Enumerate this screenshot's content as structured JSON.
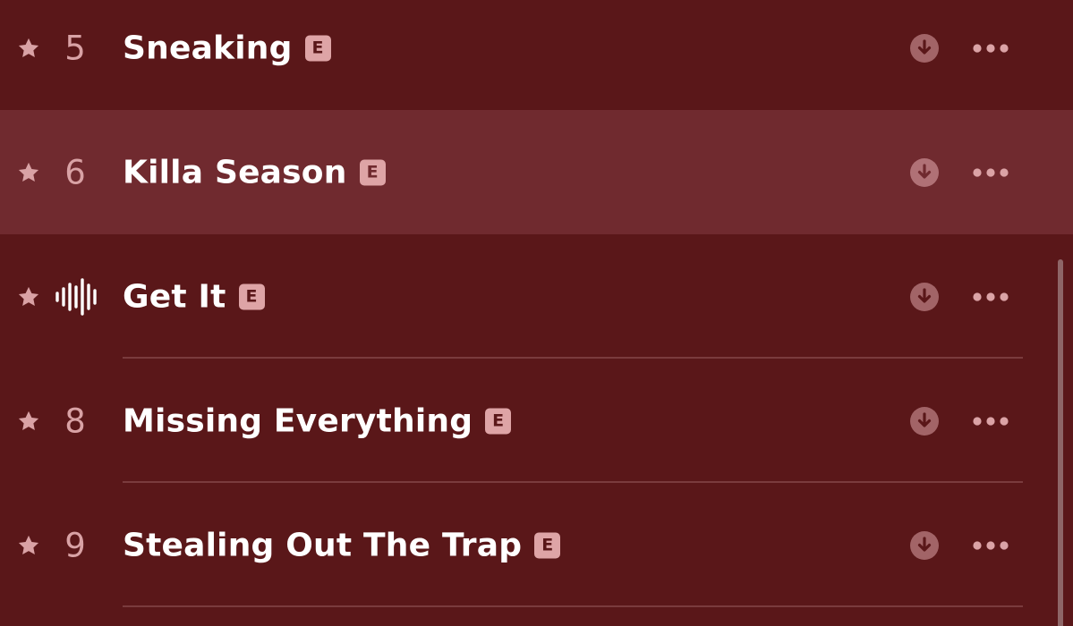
{
  "colors": {
    "background": "#5a1719",
    "highlight_row": "#702a2f",
    "accent_pink": "#d9a2a5",
    "text": "#ffffff"
  },
  "tracks": [
    {
      "number": "5",
      "title": "Sneaking",
      "explicit_label": "E",
      "highlighted": false,
      "now_playing": false,
      "divider": false
    },
    {
      "number": "6",
      "title": "Killa Season",
      "explicit_label": "E",
      "highlighted": true,
      "now_playing": false,
      "divider": false
    },
    {
      "number": "",
      "title": "Get It",
      "explicit_label": "E",
      "highlighted": false,
      "now_playing": true,
      "divider": true
    },
    {
      "number": "8",
      "title": "Missing Everything",
      "explicit_label": "E",
      "highlighted": false,
      "now_playing": false,
      "divider": true
    },
    {
      "number": "9",
      "title": "Stealing Out The Trap",
      "explicit_label": "E",
      "highlighted": false,
      "now_playing": false,
      "divider": true
    }
  ],
  "icons": {
    "favorite": "star-icon",
    "playing": "waveform-icon",
    "download": "download-icon",
    "more": "more-options-icon"
  }
}
